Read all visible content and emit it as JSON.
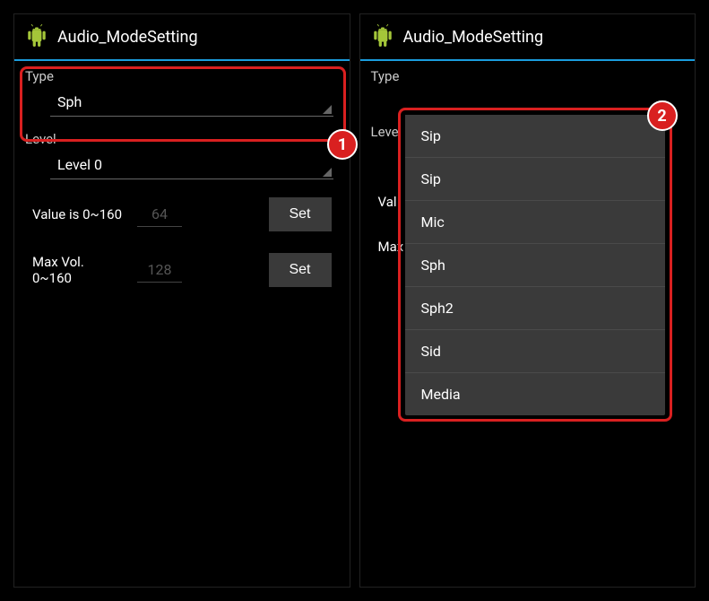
{
  "app_title": "Audio_ModeSetting",
  "panel1": {
    "type_label": "Type",
    "type_value": "Sph",
    "level_label": "Level",
    "level_value": "Level 0",
    "value_label": "Value is 0~160",
    "value_input": "64",
    "maxvol_label": "Max Vol. 0~160",
    "maxvol_input": "128",
    "set_label": "Set",
    "badge": "1"
  },
  "panel2": {
    "type_label": "Type",
    "type_value": "Sip",
    "level_label": "Leve",
    "val_label": "Val",
    "max_label": "Max",
    "dropdown_items": [
      "Sip",
      "Mic",
      "Sph",
      "Sph2",
      "Sid",
      "Media"
    ],
    "badge": "2"
  }
}
